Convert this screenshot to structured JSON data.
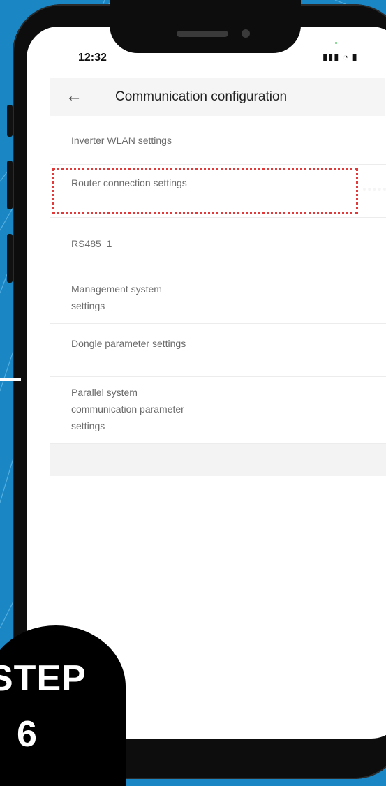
{
  "status_bar": {
    "time": "12:32",
    "icons": "▮▮▮ ◔ ▮"
  },
  "header": {
    "title": "Communication configuration"
  },
  "menu": {
    "items": [
      {
        "label": "Inverter WLAN settings"
      },
      {
        "label": "Router connection settings"
      },
      {
        "label": "RS485_1"
      },
      {
        "label": "Management system settings"
      },
      {
        "label": "Dongle parameter settings"
      },
      {
        "label": "Parallel system communication parameter settings"
      }
    ]
  },
  "step": {
    "label": "STEP",
    "number": "6"
  },
  "colors": {
    "background": "#1b86c4",
    "highlight": "#e03a3a",
    "phone": "#0d0d0d"
  }
}
